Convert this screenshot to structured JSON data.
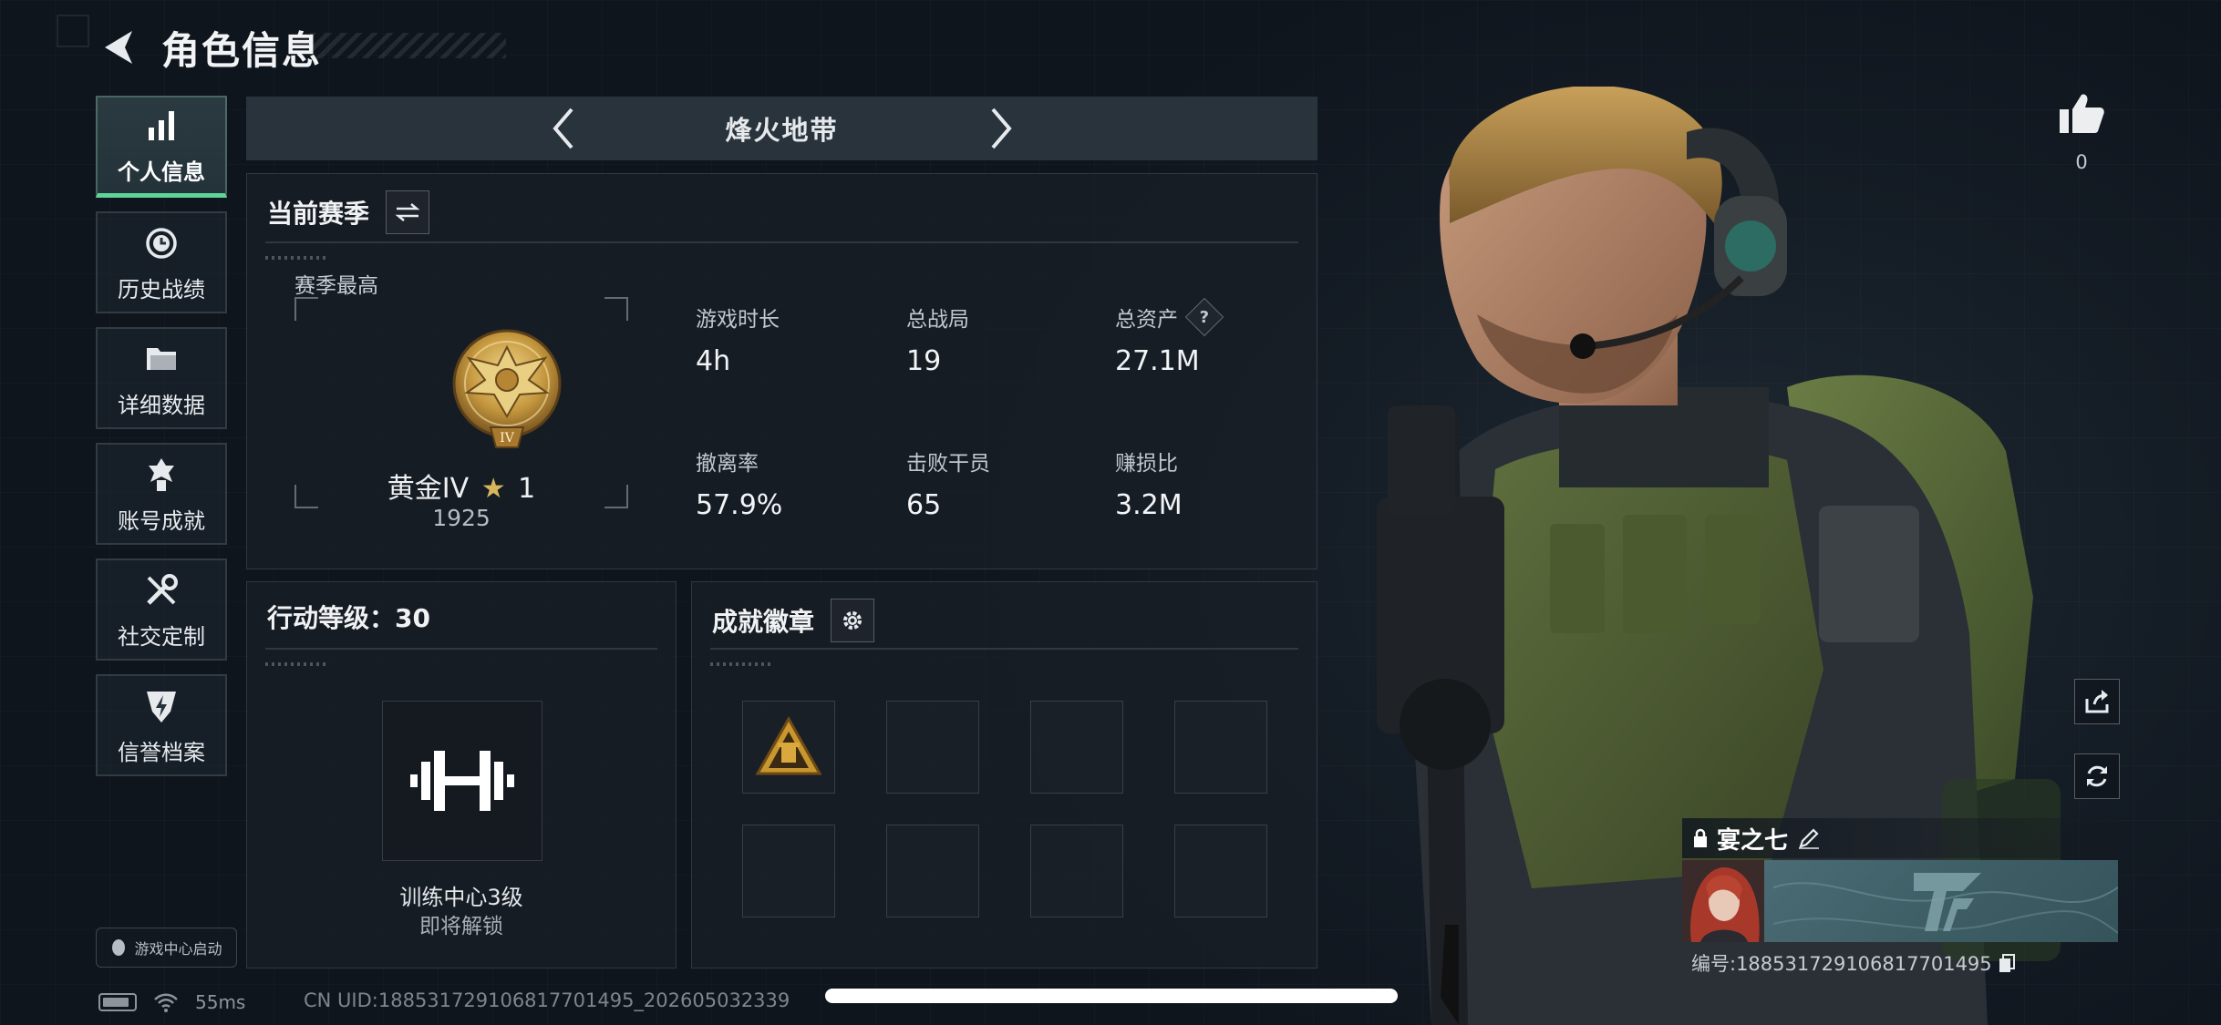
{
  "header": {
    "title": "角色信息"
  },
  "sidebar": {
    "items": [
      {
        "label": "个人信息",
        "icon": "bar-chart-icon",
        "active": true
      },
      {
        "label": "历史战绩",
        "icon": "clock-icon",
        "active": false
      },
      {
        "label": "详细数据",
        "icon": "folder-icon",
        "active": false
      },
      {
        "label": "账号成就",
        "icon": "medal-icon",
        "active": false
      },
      {
        "label": "社交定制",
        "icon": "tools-icon",
        "active": false
      },
      {
        "label": "信誉档案",
        "icon": "shield-icon",
        "active": false
      }
    ],
    "game_center": "游戏中心启动"
  },
  "mode": {
    "title": "烽火地带"
  },
  "season": {
    "title": "当前赛季",
    "best_label": "赛季最高",
    "rank_name": "黄金IV",
    "rank_star": "★",
    "rank_stars": "1",
    "rank_score": "1925",
    "badge_numeral": "IV",
    "stats": [
      {
        "label": "游戏时长",
        "value": "4h"
      },
      {
        "label": "总战局",
        "value": "19"
      },
      {
        "label": "总资产",
        "value": "27.1M",
        "help": "?"
      },
      {
        "label": "撤离率",
        "value": "57.9%"
      },
      {
        "label": "击败干员",
        "value": "65"
      },
      {
        "label": "赚损比",
        "value": "3.2M"
      }
    ]
  },
  "action_level": {
    "title": "行动等级：30",
    "training_name": "训练中心3级",
    "training_status": "即将解锁"
  },
  "badges": {
    "title": "成就徽章",
    "slots": 8,
    "filled": 1
  },
  "likes": {
    "count": "0"
  },
  "profile": {
    "name": "宴之七",
    "id_text": "编号:188531729106817701495"
  },
  "status_bar": {
    "ping": "55ms",
    "uid": "CN UID:188531729106817701495_202605032339"
  },
  "colors": {
    "accent": "#5fd39a",
    "gold": "#d8b65c",
    "background": "#0f151d",
    "banner": "#4f7179"
  }
}
